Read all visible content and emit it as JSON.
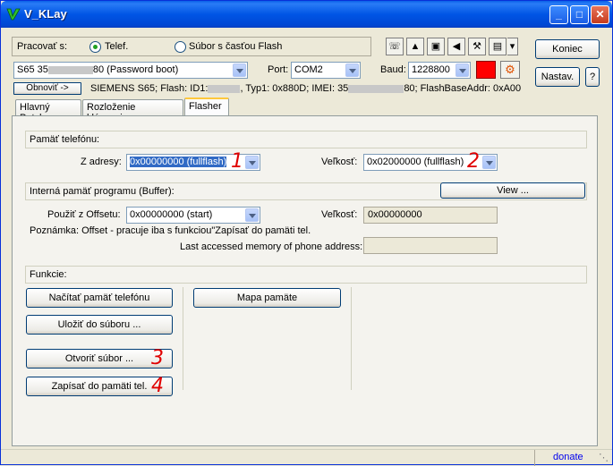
{
  "window": {
    "title": "V_KLay"
  },
  "mode": {
    "label": "Pracovať s:",
    "opt1": "Telef.",
    "opt2": "Súbor s časťou Flash"
  },
  "device": {
    "value_pre": "S65 35",
    "value_post": "80 (Password boot)"
  },
  "port": {
    "label": "Port:",
    "value": "COM2"
  },
  "baud": {
    "label": "Baud:",
    "value": "1228800"
  },
  "buttons": {
    "koniec": "Koniec",
    "nastav": "Nastav.",
    "help": "?",
    "refresh": "Obnoviť ->"
  },
  "status": {
    "p1": "SIEMENS S65; Flash: ID1:",
    "p2": ", Typ1: 0x880D; IMEI: 35",
    "p3": "80; FlashBaseAddr: 0xA00"
  },
  "tabs": [
    "Hlavný Patch",
    "Rozloženie klávesnice",
    "Flasher"
  ],
  "memory": {
    "section": "Pamäť telefónu:",
    "from_label": "Z adresy:",
    "from_value": "0x00000000 (fullflash)",
    "size_label": "Veľkosť:",
    "size_value": "0x02000000 (fullflash)"
  },
  "buffer": {
    "section": "Interná pamäť programu (Buffer):",
    "view_button": "View ...",
    "offset_label": "Použiť z Offsetu:",
    "offset_value": "0x00000000 (start)",
    "size_label": "Veľkosť:",
    "size_value": "0x00000000",
    "note": "Poznámka: Offset - pracuje iba s funkciou\"Zapísať do pamäti tel.",
    "last_label": "Last accessed memory of phone address:",
    "last_value": ""
  },
  "functions": {
    "section": "Funkcie:",
    "read": "Načítať pamäť telefónu",
    "save": "Uložiť do súboru ...",
    "open": "Otvoriť súbor ...",
    "write": "Zapísať do pamäti tel.",
    "map": "Mapa pamäte"
  },
  "annotations": {
    "n1": "1",
    "n2": "2",
    "n3": "3",
    "n4": "4"
  },
  "footer": {
    "donate": "donate"
  },
  "colors": {
    "titlebar": "#0055e5",
    "red_indicator": "#ff0000",
    "annotation": "#e00000"
  }
}
